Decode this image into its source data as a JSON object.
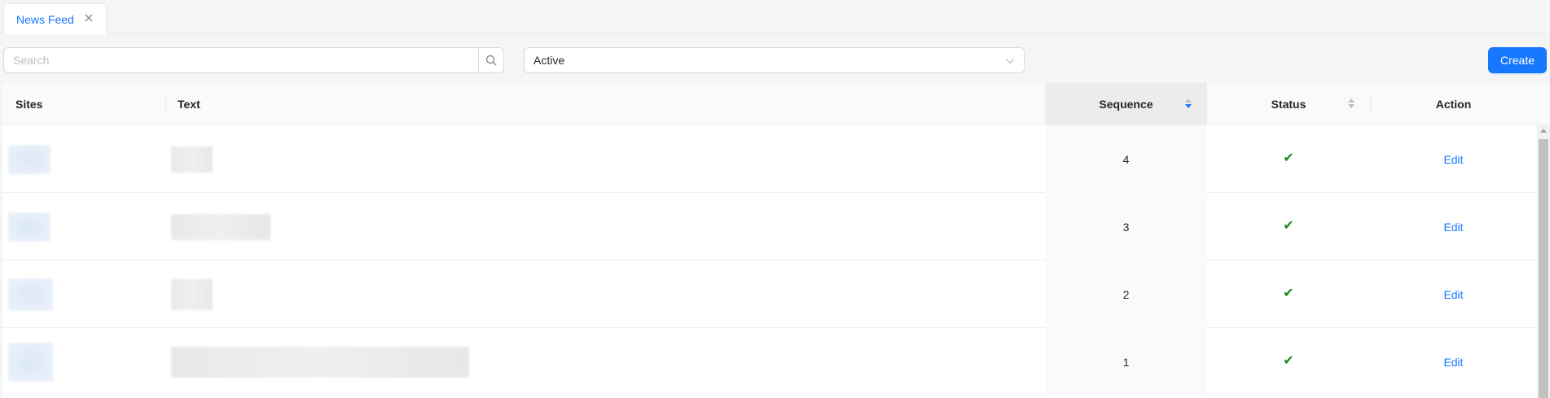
{
  "tabs": [
    {
      "label": "News Feed",
      "active": true
    }
  ],
  "toolbar": {
    "search_placeholder": "Search",
    "search_value": "",
    "status_select": {
      "value": "Active"
    },
    "create_label": "Create"
  },
  "table": {
    "columns": {
      "sites": "Sites",
      "text": "Text",
      "sequence": "Sequence",
      "status": "Status",
      "action": "Action"
    },
    "sort": {
      "column": "Sequence",
      "direction": "descending"
    },
    "rows": [
      {
        "sequence": "4",
        "status": "active",
        "action": "Edit"
      },
      {
        "sequence": "3",
        "status": "active",
        "action": "Edit"
      },
      {
        "sequence": "2",
        "status": "active",
        "action": "Edit"
      },
      {
        "sequence": "1",
        "status": "active",
        "action": "Edit"
      }
    ]
  },
  "colors": {
    "accent": "#1677ff",
    "status_check": "#1a8a1a"
  },
  "icons": [
    "close-icon",
    "search-icon",
    "chevron-down-icon",
    "sort-icon",
    "check-icon"
  ]
}
